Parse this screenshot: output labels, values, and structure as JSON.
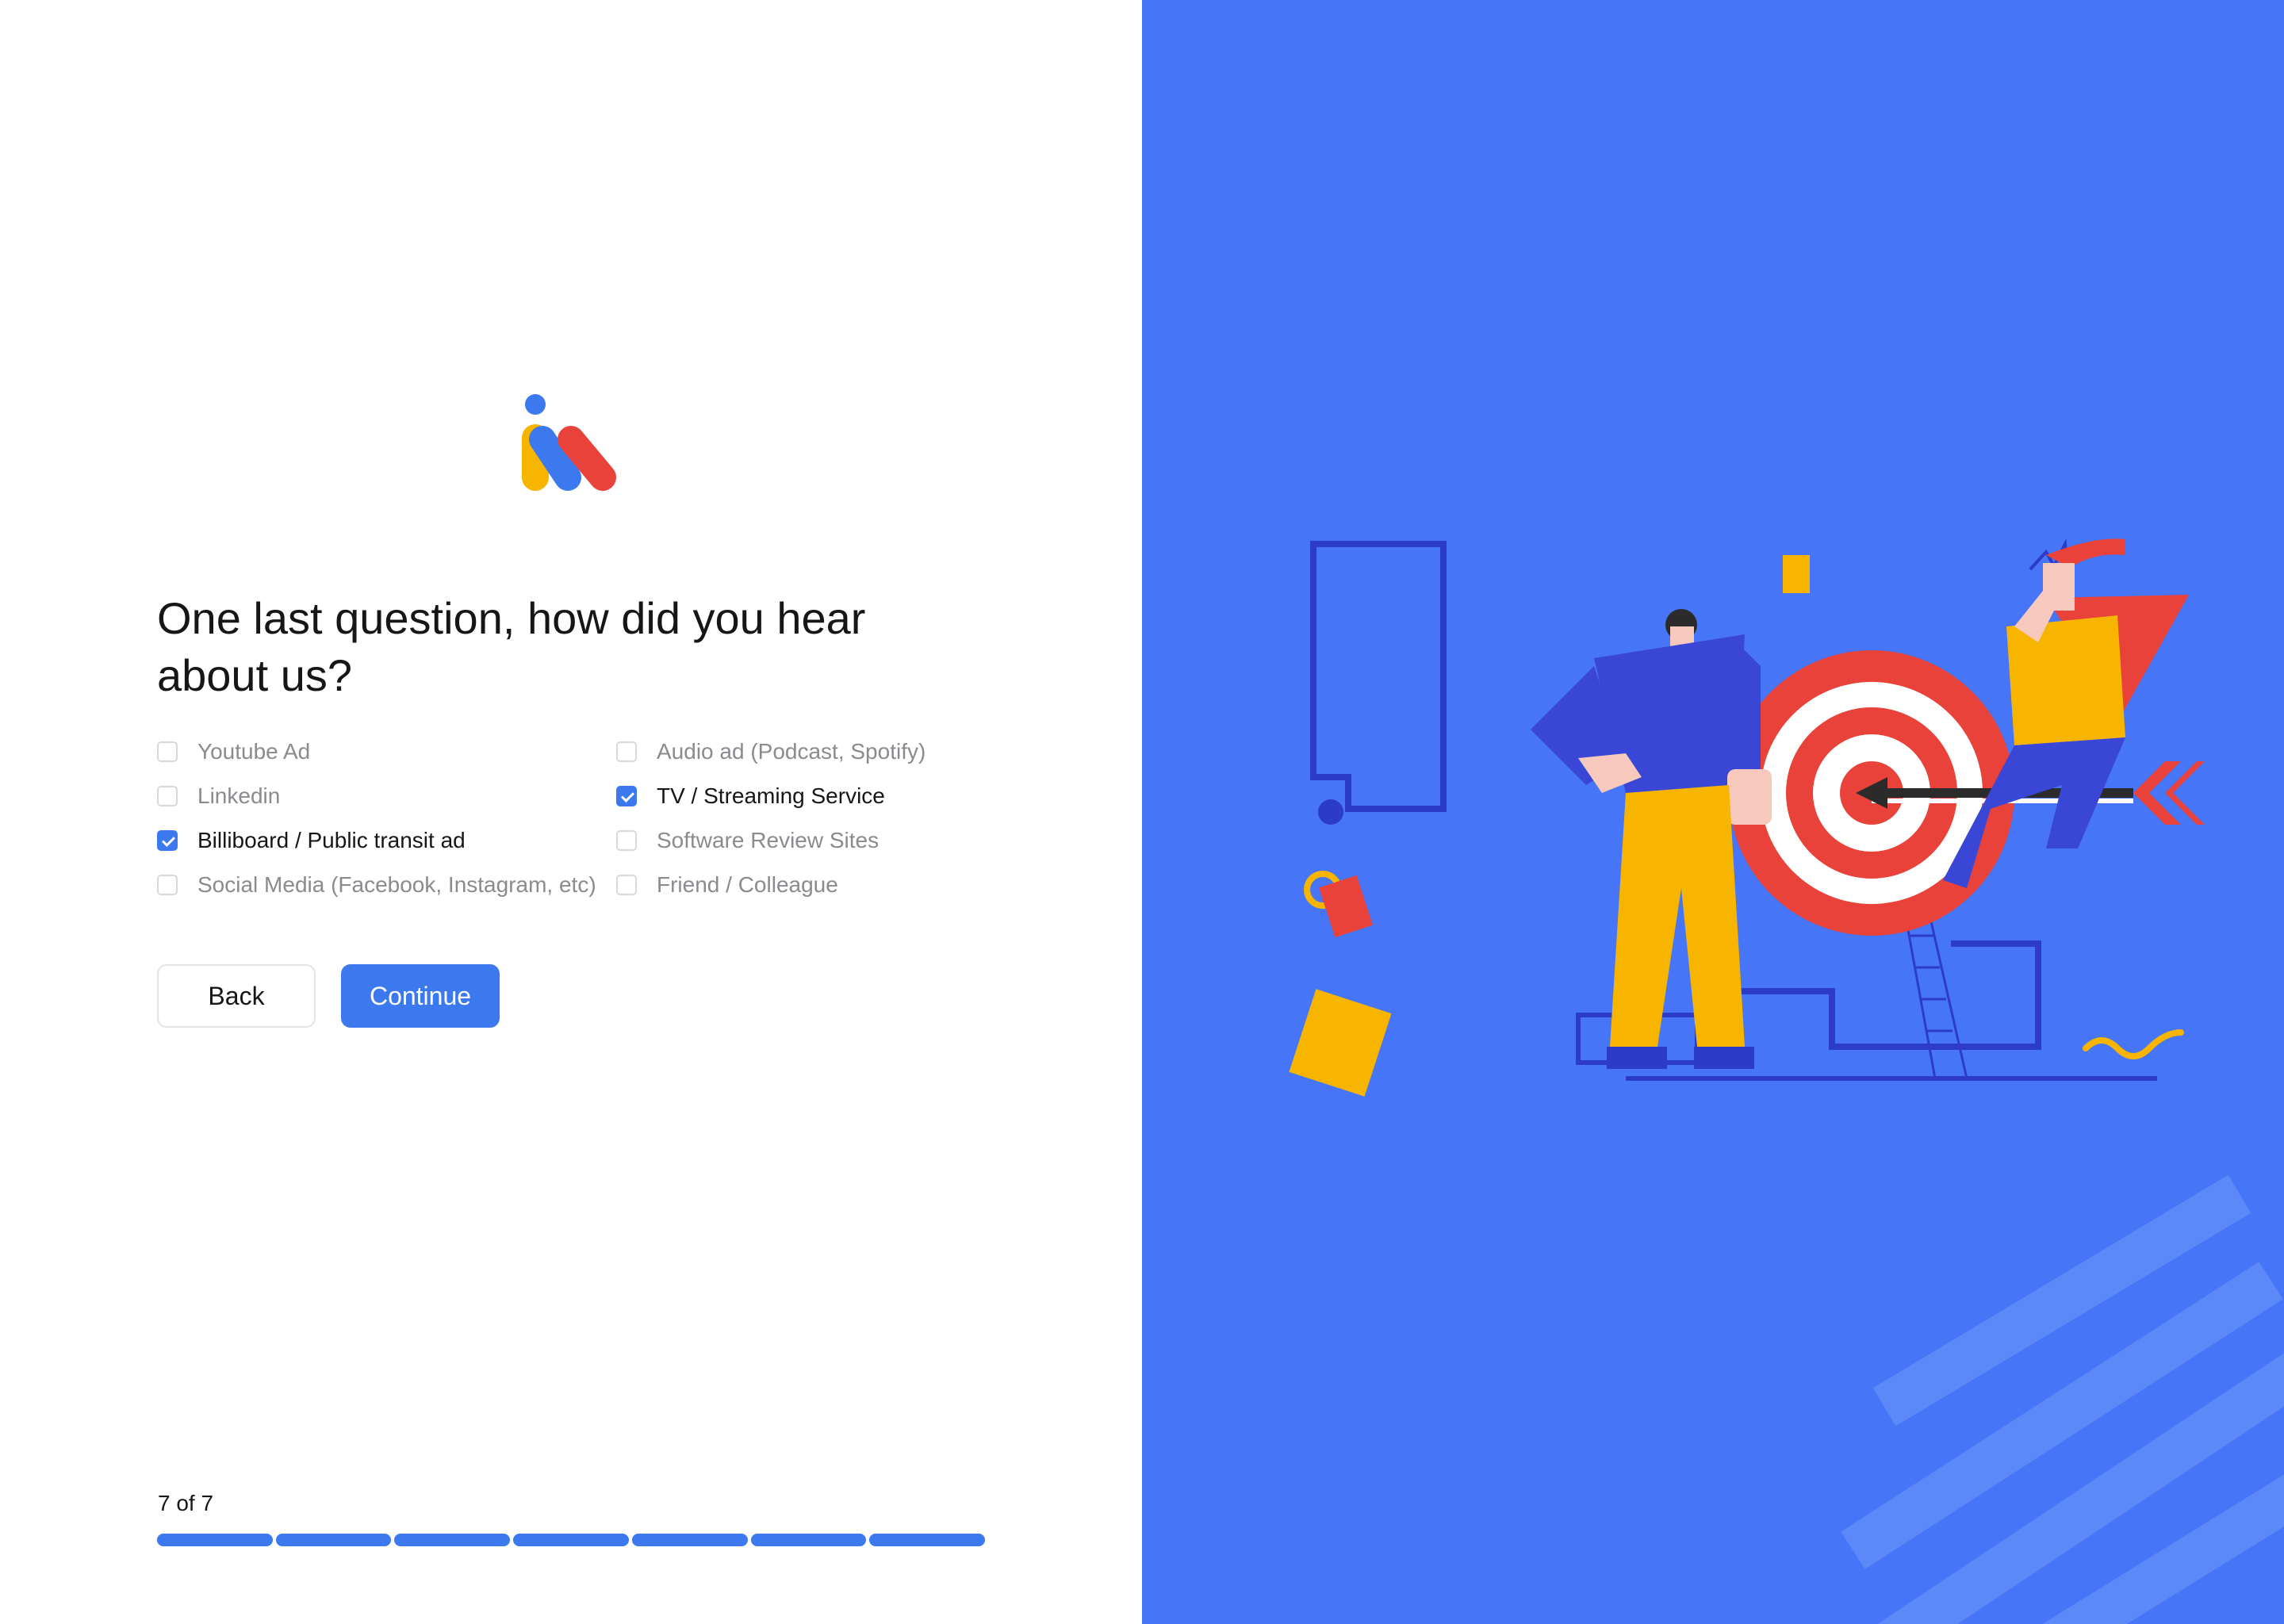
{
  "brand": {
    "logo_icon": "brand-logo-icon",
    "colors": {
      "blue": "#3c79ee",
      "yellow": "#f7b500",
      "red": "#e8423a"
    }
  },
  "question": {
    "title": "One last question, how did you hear about us?"
  },
  "options": [
    {
      "label": "Youtube Ad",
      "checked": false
    },
    {
      "label": "Linkedin",
      "checked": false
    },
    {
      "label": "Billiboard / Public transit ad",
      "checked": true
    },
    {
      "label": "Social Media (Facebook, Instagram, etc)",
      "checked": false
    },
    {
      "label": "Audio ad (Podcast, Spotify)",
      "checked": false
    },
    {
      "label": "TV / Streaming Service",
      "checked": true
    },
    {
      "label": "Software Review Sites",
      "checked": false
    },
    {
      "label": "Friend / Colleague",
      "checked": false
    }
  ],
  "actions": {
    "back_label": "Back",
    "continue_label": "Continue"
  },
  "progress": {
    "label": "7 of 7",
    "current": 7,
    "total": 7
  },
  "panel": {
    "background": "#4675f7",
    "illustration": "target-arrow-illustration"
  }
}
